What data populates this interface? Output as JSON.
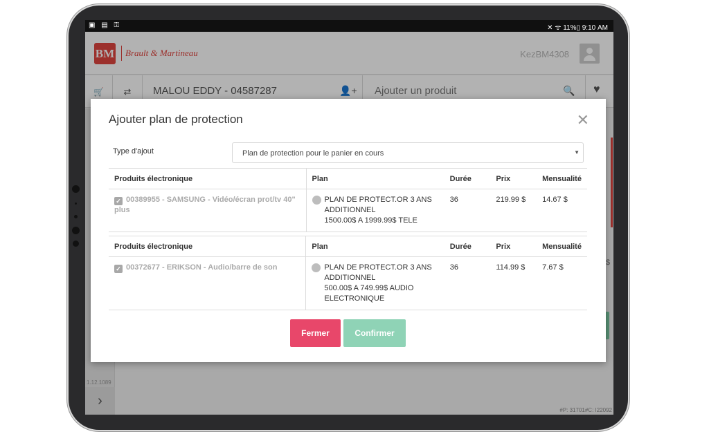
{
  "status_bar": {
    "left_icons": "▣ ▤ ⚿",
    "right_text": "✕ ᯤ 11%▯ 9:10 AM"
  },
  "header": {
    "logo_initials": "BM",
    "brand_name": "Brault & Martineau",
    "user_code": "KezBM4308"
  },
  "toolbar": {
    "cart_icon": "🛒",
    "swap_icon": "⇄",
    "customer": "MALOU EDDY - 04587287",
    "add_person_icon": "👤+",
    "search_label": "Ajouter un produit",
    "search_icon": "🔍",
    "heart_icon": "♥"
  },
  "background": {
    "version": "1.12.1089",
    "dollar": "$",
    "footer_code": "#P: 31701#C: I22092"
  },
  "modal": {
    "title": "Ajouter plan de protection",
    "type_label": "Type d'ajout",
    "type_value": "Plan de protection pour le panier en cours",
    "headers": {
      "product": "Produits électronique",
      "plan": "Plan",
      "duration": "Durée",
      "price": "Prix",
      "monthly": "Mensualité"
    },
    "rows": [
      {
        "product": "00389955 - SAMSUNG - Vidéo/écran prot/tv 40\" plus",
        "plan_lines": [
          "PLAN DE PROTECT.OR 3 ANS",
          "ADDITIONNEL",
          "1500.00$ A 1999.99$ TELE"
        ],
        "duration": "36",
        "price": "219.99 $",
        "monthly": "14.67 $"
      },
      {
        "product": "00372677 - ERIKSON - Audio/barre de son",
        "plan_lines": [
          "PLAN DE PROTECT.OR 3 ANS",
          "ADDITIONNEL",
          "500.00$ A 749.99$ AUDIO",
          "ELECTRONIQUE"
        ],
        "duration": "36",
        "price": "114.99 $",
        "monthly": "7.67 $"
      }
    ],
    "close_button": "Fermer",
    "confirm_button": "Confirmer"
  },
  "colors": {
    "brand_red": "#e0453f",
    "close_button": "#e8476a",
    "confirm_button": "#8fd3b6"
  }
}
